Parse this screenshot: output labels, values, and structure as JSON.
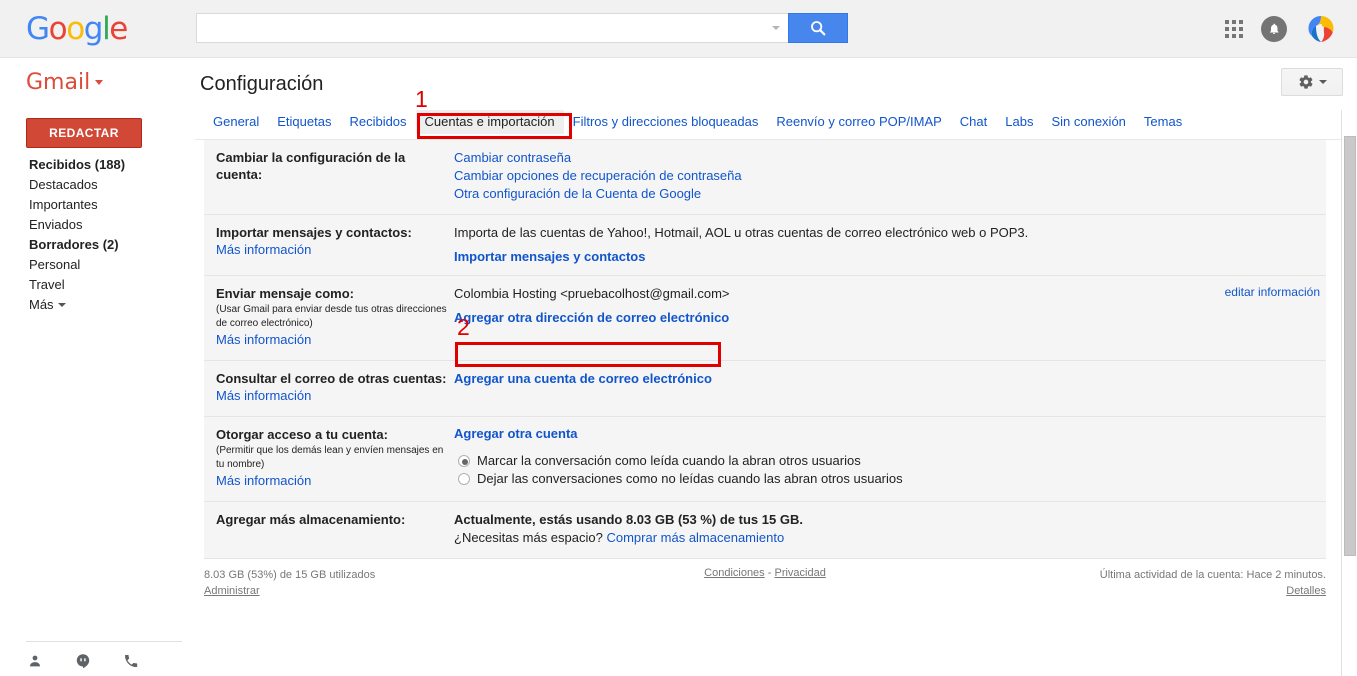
{
  "browser": {
    "topbar": {
      "logo": "Google",
      "search_value": "",
      "search_placeholder": "",
      "search_icon": "search-icon",
      "apps_icon": "apps-grid-icon",
      "bell_icon": "notifications-bell-icon",
      "avatar_icon": "profile-avatar"
    }
  },
  "header": {
    "product": "Gmail",
    "page_title": "Configuración",
    "gear_icon": "gear-icon"
  },
  "sidebar": {
    "compose_label": "REDACTAR",
    "items": [
      {
        "label": "Recibidos (188)",
        "bold": true
      },
      {
        "label": "Destacados",
        "bold": false
      },
      {
        "label": "Importantes",
        "bold": false
      },
      {
        "label": "Enviados",
        "bold": false
      },
      {
        "label": "Borradores (2)",
        "bold": true
      },
      {
        "label": "Personal",
        "bold": false
      },
      {
        "label": "Travel",
        "bold": false
      },
      {
        "label": "Más",
        "bold": false
      }
    ],
    "bottom_icons": [
      "person-icon",
      "hangouts-icon",
      "phone-icon"
    ]
  },
  "tabs": [
    {
      "label": "General",
      "active": false
    },
    {
      "label": "Etiquetas",
      "active": false
    },
    {
      "label": "Recibidos",
      "active": false
    },
    {
      "label": "Cuentas e importación",
      "active": true
    },
    {
      "label": "Filtros y direcciones bloqueadas",
      "active": false
    },
    {
      "label": "Reenvío y correo POP/IMAP",
      "active": false
    },
    {
      "label": "Chat",
      "active": false
    },
    {
      "label": "Labs",
      "active": false
    },
    {
      "label": "Sin conexión",
      "active": false
    },
    {
      "label": "Temas",
      "active": false
    }
  ],
  "settings": {
    "change_account": {
      "label": "Cambiar la configuración de la cuenta:",
      "links": [
        "Cambiar contraseña",
        "Cambiar opciones de recuperación de contraseña",
        "Otra configuración de la Cuenta de Google"
      ]
    },
    "import": {
      "label": "Importar mensajes y contactos:",
      "more_info": "Más información",
      "description": "Importa de las cuentas de Yahoo!, Hotmail, AOL u otras cuentas de correo electrónico web o POP3.",
      "action": "Importar mensajes y contactos"
    },
    "send_as": {
      "label": "Enviar mensaje como:",
      "note": "(Usar Gmail para enviar desde tus otras direcciones de correo electrónico)",
      "more_info": "Más información",
      "address": "Colombia Hosting <pruebacolhost@gmail.com>",
      "edit_link": "editar información",
      "action": "Agregar otra dirección de correo electrónico"
    },
    "check_mail": {
      "label": "Consultar el correo de otras cuentas:",
      "more_info": "Más información",
      "action": "Agregar una cuenta de correo electrónico"
    },
    "grant_access": {
      "label": "Otorgar acceso a tu cuenta:",
      "note": "(Permitir que los demás lean y envíen mensajes en tu nombre)",
      "more_info": "Más información",
      "action": "Agregar otra cuenta",
      "options": [
        {
          "label": "Marcar la conversación como leída cuando la abran otros usuarios",
          "selected": true
        },
        {
          "label": "Dejar las conversaciones como no leídas cuando las abran otros usuarios",
          "selected": false
        }
      ]
    },
    "storage": {
      "label": "Agregar más almacenamiento:",
      "usage": "Actualmente, estás usando 8.03 GB (53 %) de tus 15 GB.",
      "need_more": "¿Necesitas más espacio?",
      "buy_link": "Comprar más almacenamiento"
    }
  },
  "footer": {
    "storage_text": "8.03 GB (53%) de 15 GB utilizados",
    "manage_link": "Administrar",
    "terms_link": "Condiciones",
    "separator": "-",
    "privacy_link": "Privacidad",
    "last_activity": "Última actividad de la cuenta: Hace 2 minutos.",
    "details_link": "Detalles"
  },
  "annotations": [
    {
      "number": "1",
      "target": "tab-cuentas-e-importacion"
    },
    {
      "number": "2",
      "target": "add-email-account-link"
    }
  ],
  "colors": {
    "accent_red": "#d14836",
    "link_blue": "#1155cc",
    "annotation_red": "#e00000",
    "button_blue": "#4787ed"
  }
}
